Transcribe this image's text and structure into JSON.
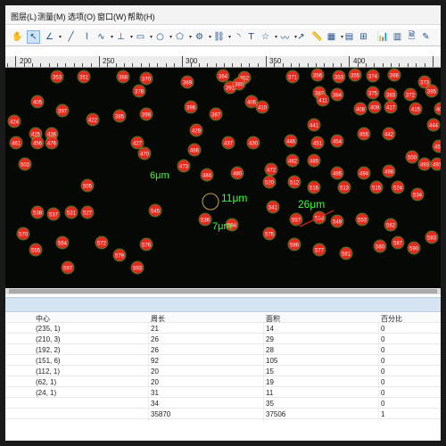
{
  "menubar": {
    "items": [
      "图层(L)",
      "测量(M)",
      "选项(O)",
      "窗口(W)",
      "帮助(H)"
    ]
  },
  "toolbar": {
    "tools": [
      "pan-hand-icon",
      "select-arrow-icon",
      "angle-icon",
      "line-icon",
      "polyline-icon",
      "curve-icon",
      "perpendicular-icon",
      "rectangle-icon",
      "ellipse-icon",
      "polygon-icon",
      "circle-gear-icon",
      "link-icon",
      "arc-icon",
      "text-icon",
      "star-icon",
      "wave-icon",
      "arrow-icon",
      "ruler-calibrate-icon",
      "grid-icon",
      "bar-chart-icon",
      "measure-table-icon",
      "export-icon",
      "chart-icon"
    ]
  },
  "ruler": {
    "labels": [
      "200",
      "250",
      "300",
      "350",
      "400"
    ]
  },
  "image": {
    "cell_labels": [
      "353",
      "351",
      "368",
      "370",
      "364",
      "352",
      "371",
      "356",
      "353",
      "355",
      "374",
      "366",
      "373",
      "378",
      "369",
      "391",
      "380",
      "382",
      "384",
      "375",
      "383",
      "372",
      "395",
      "405",
      "397",
      "385",
      "398",
      "396",
      "387",
      "406",
      "410",
      "411",
      "408",
      "409",
      "417",
      "415",
      "409",
      "424",
      "422",
      "425",
      "436",
      "427",
      "429",
      "437",
      "430",
      "446",
      "441",
      "451",
      "454",
      "455",
      "442",
      "444",
      "457",
      "461",
      "456",
      "476",
      "466",
      "470",
      "473",
      "484",
      "480",
      "472",
      "482",
      "485",
      "495",
      "494",
      "498",
      "500",
      "493",
      "497",
      "503",
      "505",
      "520",
      "512",
      "516",
      "513",
      "515",
      "524",
      "534",
      "538",
      "537",
      "531",
      "527",
      "545",
      "536",
      "541",
      "557",
      "563",
      "549",
      "553",
      "562",
      "570",
      "555",
      "564",
      "572",
      "579",
      "576",
      "584",
      "575",
      "586",
      "577",
      "581",
      "580",
      "587",
      "590",
      "583",
      "597",
      "593"
    ],
    "measurements": {
      "m1": "6μm",
      "m2": "11μm",
      "m3": "7μm",
      "m4": "26μm"
    },
    "colors": {
      "background": "#050805",
      "cell": "#e8271f",
      "cell_halo": "#8fbf3a",
      "measure_text": "#39ff39",
      "selection_ring": "#c9a24a"
    }
  },
  "results": {
    "headers": [
      "中心",
      "周长",
      "面积",
      "百分比"
    ],
    "rows": [
      [
        "(235, 1)",
        "21",
        "14",
        "0"
      ],
      [
        "(210, 3)",
        "26",
        "29",
        "0"
      ],
      [
        "(192, 2)",
        "26",
        "28",
        "0"
      ],
      [
        "(151, 6)",
        "92",
        "105",
        "0"
      ],
      [
        "(112, 1)",
        "20",
        "15",
        "0"
      ],
      [
        "(62, 1)",
        "20",
        "19",
        "0"
      ],
      [
        "(24, 1)",
        "31",
        "11",
        "0"
      ],
      [
        "",
        "34",
        "35",
        "0"
      ],
      [
        "",
        "35870",
        "37506",
        "1"
      ]
    ]
  }
}
